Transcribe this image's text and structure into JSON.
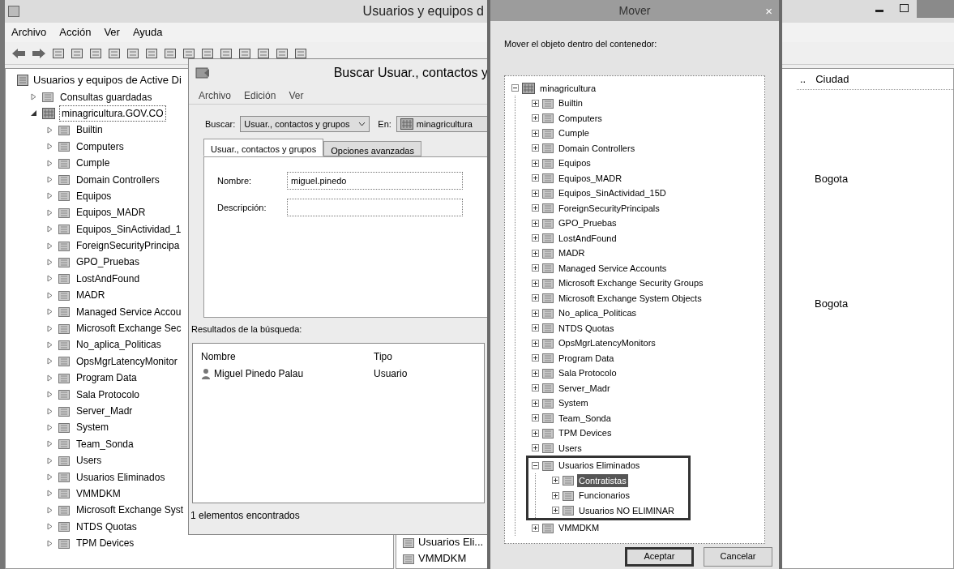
{
  "main_window": {
    "title": "Usuarios y equipos d",
    "menu": [
      "Archivo",
      "Acción",
      "Ver",
      "Ayuda"
    ],
    "tree": {
      "root": "Usuarios y equipos de Active Di",
      "items": [
        {
          "label": "Consultas guardadas",
          "expanded": false,
          "selected": false
        },
        {
          "label": "minagricultura.GOV.CO",
          "expanded": true,
          "selected": true,
          "children": [
            {
              "label": "Builtin",
              "expanded": false,
              "selected": false
            },
            {
              "label": "Computers",
              "expanded": false,
              "selected": false
            },
            {
              "label": "Cumple",
              "expanded": false,
              "selected": false
            },
            {
              "label": "Domain Controllers",
              "expanded": false,
              "selected": false
            },
            {
              "label": "Equipos",
              "expanded": false,
              "selected": false
            },
            {
              "label": "Equipos_MADR",
              "expanded": false,
              "selected": false
            },
            {
              "label": "Equipos_SinActividad_1",
              "expanded": false,
              "selected": false
            },
            {
              "label": "ForeignSecurityPrincipa",
              "expanded": false,
              "selected": false
            },
            {
              "label": "GPO_Pruebas",
              "expanded": false,
              "selected": false
            },
            {
              "label": "LostAndFound",
              "expanded": false,
              "selected": false
            },
            {
              "label": "MADR",
              "expanded": false,
              "selected": false
            },
            {
              "label": "Managed Service Accou",
              "expanded": false,
              "selected": false
            },
            {
              "label": "Microsoft Exchange Sec",
              "expanded": false,
              "selected": false
            },
            {
              "label": "No_aplica_Politicas",
              "expanded": false,
              "selected": false
            },
            {
              "label": "OpsMgrLatencyMonitor",
              "expanded": false,
              "selected": false
            },
            {
              "label": "Program Data",
              "expanded": false,
              "selected": false
            },
            {
              "label": "Sala Protocolo",
              "expanded": false,
              "selected": false
            },
            {
              "label": "Server_Madr",
              "expanded": false,
              "selected": false
            },
            {
              "label": "System",
              "expanded": false,
              "selected": false
            },
            {
              "label": "Team_Sonda",
              "expanded": false,
              "selected": false
            },
            {
              "label": "Users",
              "expanded": false,
              "selected": false
            },
            {
              "label": "Usuarios Eliminados",
              "expanded": false,
              "selected": false
            },
            {
              "label": "VMMDKM",
              "expanded": false,
              "selected": false
            },
            {
              "label": "Microsoft Exchange Syst",
              "expanded": false,
              "selected": false
            },
            {
              "label": "NTDS Quotas",
              "expanded": false,
              "selected": false
            },
            {
              "label": "TPM Devices",
              "expanded": false,
              "selected": false
            }
          ]
        }
      ]
    },
    "list": {
      "columns": [
        "..",
        "Ciudad"
      ],
      "cities": [
        "Bogota",
        "Bogota"
      ],
      "names": [
        "Usuarios Eli...",
        "VMMDKM"
      ]
    }
  },
  "find_dialog": {
    "title": "Buscar Usuar., contactos y",
    "menu": [
      "Archivo",
      "Edición",
      "Ver"
    ],
    "find_label": "Buscar:",
    "find_value": "Usuar., contactos y grupos",
    "in_label": "En:",
    "in_value": "minagricultura",
    "tabs": [
      {
        "label": "Usuar., contactos y grupos",
        "selected": true
      },
      {
        "label": "Opciones avanzadas",
        "selected": false
      }
    ],
    "fields": [
      {
        "label": "Nombre:",
        "value": "miguel.pinedo"
      },
      {
        "label": "Descripción:"
      }
    ],
    "results_label": "Resultados de la búsqueda:",
    "results": {
      "columns": [
        "Nombre",
        "Tipo"
      ],
      "rows": [
        [
          "Miguel Pinedo Palau",
          "Usuario"
        ]
      ]
    },
    "status": "1 elementos encontrados"
  },
  "move_dialog": {
    "title": "Mover",
    "close": "×",
    "prompt": "Mover el objeto dentro del contenedor:",
    "tree": {
      "label": "minagricultura",
      "expanded": true,
      "selected": false,
      "children": [
        {
          "label": "Builtin",
          "expanded": false,
          "selected": false
        },
        {
          "label": "Computers",
          "expanded": false,
          "selected": false
        },
        {
          "label": "Cumple",
          "expanded": false,
          "selected": false
        },
        {
          "label": "Domain Controllers",
          "expanded": false,
          "selected": false
        },
        {
          "label": "Equipos",
          "expanded": false,
          "selected": false
        },
        {
          "label": "Equipos_MADR",
          "expanded": false,
          "selected": false
        },
        {
          "label": "Equipos_SinActividad_15D",
          "expanded": false,
          "selected": false
        },
        {
          "label": "ForeignSecurityPrincipals",
          "expanded": false,
          "selected": false
        },
        {
          "label": "GPO_Pruebas",
          "expanded": false,
          "selected": false
        },
        {
          "label": "LostAndFound",
          "expanded": false,
          "selected": false
        },
        {
          "label": "MADR",
          "expanded": false,
          "selected": false
        },
        {
          "label": "Managed Service Accounts",
          "expanded": false,
          "selected": false
        },
        {
          "label": "Microsoft Exchange Security Groups",
          "expanded": false,
          "selected": false
        },
        {
          "label": "Microsoft Exchange System Objects",
          "expanded": false,
          "selected": false
        },
        {
          "label": "No_aplica_Politicas",
          "expanded": false,
          "selected": false
        },
        {
          "label": "NTDS Quotas",
          "expanded": false,
          "selected": false
        },
        {
          "label": "OpsMgrLatencyMonitors",
          "expanded": false,
          "selected": false
        },
        {
          "label": "Program Data",
          "expanded": false,
          "selected": false
        },
        {
          "label": "Sala Protocolo",
          "expanded": false,
          "selected": false
        },
        {
          "label": "Server_Madr",
          "expanded": false,
          "selected": false
        },
        {
          "label": "System",
          "expanded": false,
          "selected": false
        },
        {
          "label": "Team_Sonda",
          "expanded": false,
          "selected": false
        },
        {
          "label": "TPM Devices",
          "expanded": false,
          "selected": false
        },
        {
          "label": "Users",
          "expanded": false,
          "selected": false
        },
        {
          "label": "Usuarios Eliminados",
          "expanded": true,
          "selected": false,
          "children": [
            {
              "label": "Contratistas",
              "expanded": false,
              "selected": true
            },
            {
              "label": "Funcionarios",
              "expanded": false,
              "selected": false
            },
            {
              "label": "Usuarios NO ELIMINAR",
              "expanded": false,
              "selected": false
            }
          ]
        },
        {
          "label": "VMMDKM",
          "expanded": false,
          "selected": false
        }
      ]
    },
    "buttons": [
      {
        "label": "Aceptar",
        "default": true
      },
      {
        "label": "Cancelar",
        "default": false
      }
    ]
  }
}
